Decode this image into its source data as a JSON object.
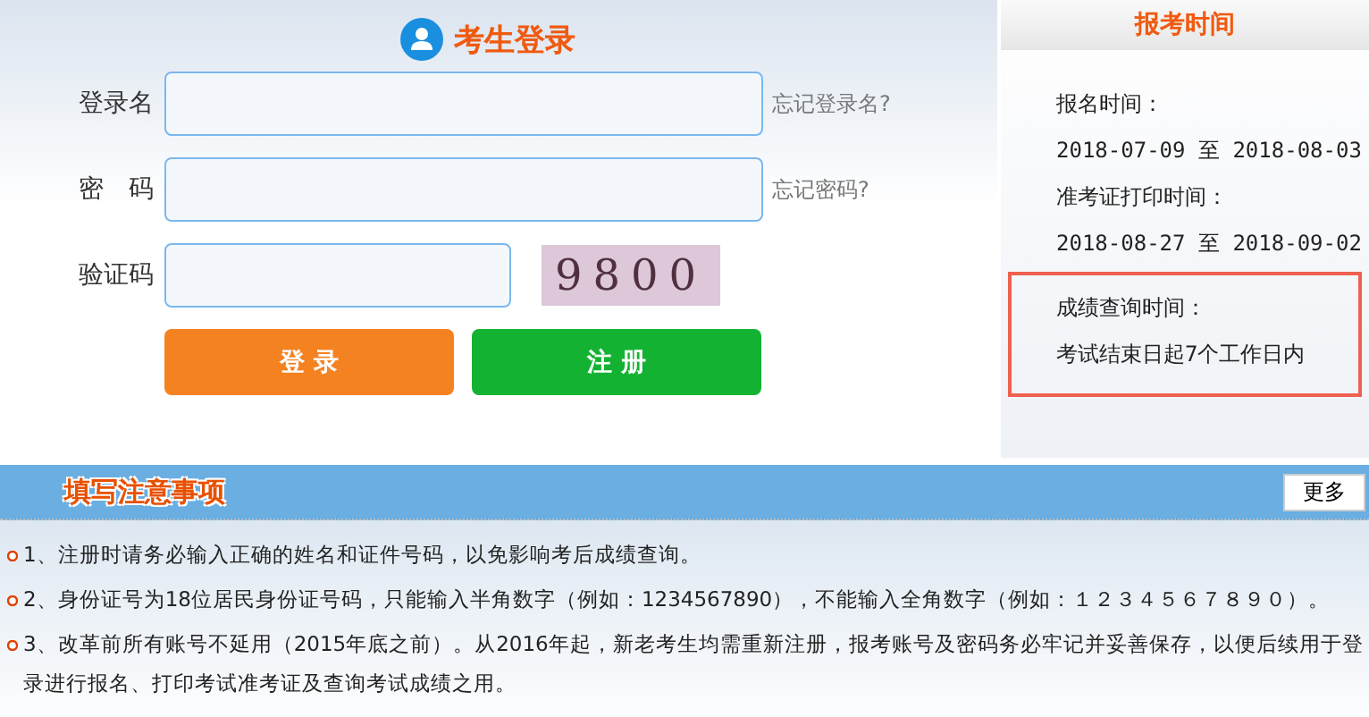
{
  "login": {
    "title": "考生登录",
    "fields": [
      {
        "kind": "text",
        "label": "登录名",
        "link": "忘记登录名?"
      },
      {
        "kind": "password",
        "label": "密　码",
        "link": "忘记密码?"
      },
      {
        "kind": "captcha",
        "label": "验证码",
        "captcha": "9800"
      }
    ],
    "buttons": [
      {
        "label": "登 录",
        "color": "#f58220"
      },
      {
        "label": "注 册",
        "color": "#14b232"
      }
    ]
  },
  "schedule": {
    "title": "报考时间",
    "items": [
      {
        "label": "报名时间：",
        "value": "2018-07-09 至 2018-08-03",
        "highlighted": false
      },
      {
        "label": "准考证打印时间：",
        "value": "2018-08-27 至 2018-09-02",
        "highlighted": false
      },
      {
        "label": "成绩查询时间：",
        "value": "考试结束日起7个工作日内",
        "highlighted": true
      }
    ]
  },
  "notices": {
    "title": "填写注意事项",
    "more": "更多",
    "items": [
      "1、注册时请务必输入正确的姓名和证件号码，以免影响考后成绩查询。",
      "2、身份证号为18位居民身份证号码，只能输入半角数字（例如：1234567890），不能输入全角数字（例如：１２３４５６７８９０）。",
      "3、改革前所有账号不延用（2015年底之前）。从2016年起，新老考生均需重新注册，报考账号及密码务必牢记并妥善保存，以便后续用于登录进行报名、打印考试准考证及查询考试成绩之用。"
    ]
  }
}
